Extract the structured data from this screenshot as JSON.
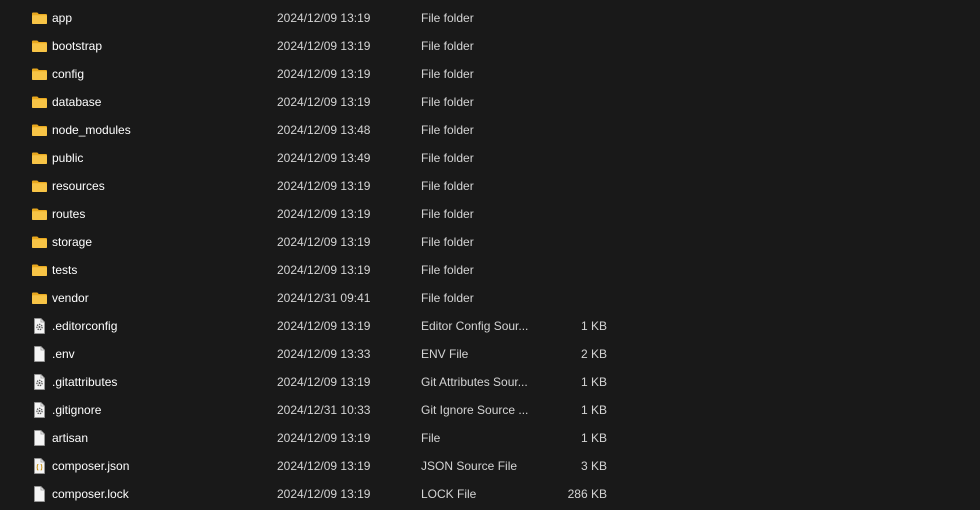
{
  "files": [
    {
      "name": "app",
      "date": "2024/12/09 13:19",
      "type": "File folder",
      "size": "",
      "icon": "folder-icon"
    },
    {
      "name": "bootstrap",
      "date": "2024/12/09 13:19",
      "type": "File folder",
      "size": "",
      "icon": "folder-icon"
    },
    {
      "name": "config",
      "date": "2024/12/09 13:19",
      "type": "File folder",
      "size": "",
      "icon": "folder-icon"
    },
    {
      "name": "database",
      "date": "2024/12/09 13:19",
      "type": "File folder",
      "size": "",
      "icon": "folder-icon"
    },
    {
      "name": "node_modules",
      "date": "2024/12/09 13:48",
      "type": "File folder",
      "size": "",
      "icon": "folder-icon"
    },
    {
      "name": "public",
      "date": "2024/12/09 13:49",
      "type": "File folder",
      "size": "",
      "icon": "folder-icon"
    },
    {
      "name": "resources",
      "date": "2024/12/09 13:19",
      "type": "File folder",
      "size": "",
      "icon": "folder-icon"
    },
    {
      "name": "routes",
      "date": "2024/12/09 13:19",
      "type": "File folder",
      "size": "",
      "icon": "folder-icon"
    },
    {
      "name": "storage",
      "date": "2024/12/09 13:19",
      "type": "File folder",
      "size": "",
      "icon": "folder-icon"
    },
    {
      "name": "tests",
      "date": "2024/12/09 13:19",
      "type": "File folder",
      "size": "",
      "icon": "folder-icon"
    },
    {
      "name": "vendor",
      "date": "2024/12/31 09:41",
      "type": "File folder",
      "size": "",
      "icon": "folder-icon"
    },
    {
      "name": ".editorconfig",
      "date": "2024/12/09 13:19",
      "type": "Editor Config Sour...",
      "size": "1 KB",
      "icon": "config-file-icon"
    },
    {
      "name": ".env",
      "date": "2024/12/09 13:33",
      "type": "ENV File",
      "size": "2 KB",
      "icon": "file-icon"
    },
    {
      "name": ".gitattributes",
      "date": "2024/12/09 13:19",
      "type": "Git Attributes Sour...",
      "size": "1 KB",
      "icon": "config-file-icon"
    },
    {
      "name": ".gitignore",
      "date": "2024/12/31 10:33",
      "type": "Git Ignore Source ...",
      "size": "1 KB",
      "icon": "config-file-icon"
    },
    {
      "name": "artisan",
      "date": "2024/12/09 13:19",
      "type": "File",
      "size": "1 KB",
      "icon": "file-icon"
    },
    {
      "name": "composer.json",
      "date": "2024/12/09 13:19",
      "type": "JSON Source File",
      "size": "3 KB",
      "icon": "json-file-icon"
    },
    {
      "name": "composer.lock",
      "date": "2024/12/09 13:19",
      "type": "LOCK File",
      "size": "286 KB",
      "icon": "file-icon"
    }
  ],
  "colors": {
    "background": "#191919",
    "folder": "#f7c446",
    "folder_dark": "#e8a81e",
    "file_page": "#f4f4f4",
    "text": "#ffffff"
  }
}
